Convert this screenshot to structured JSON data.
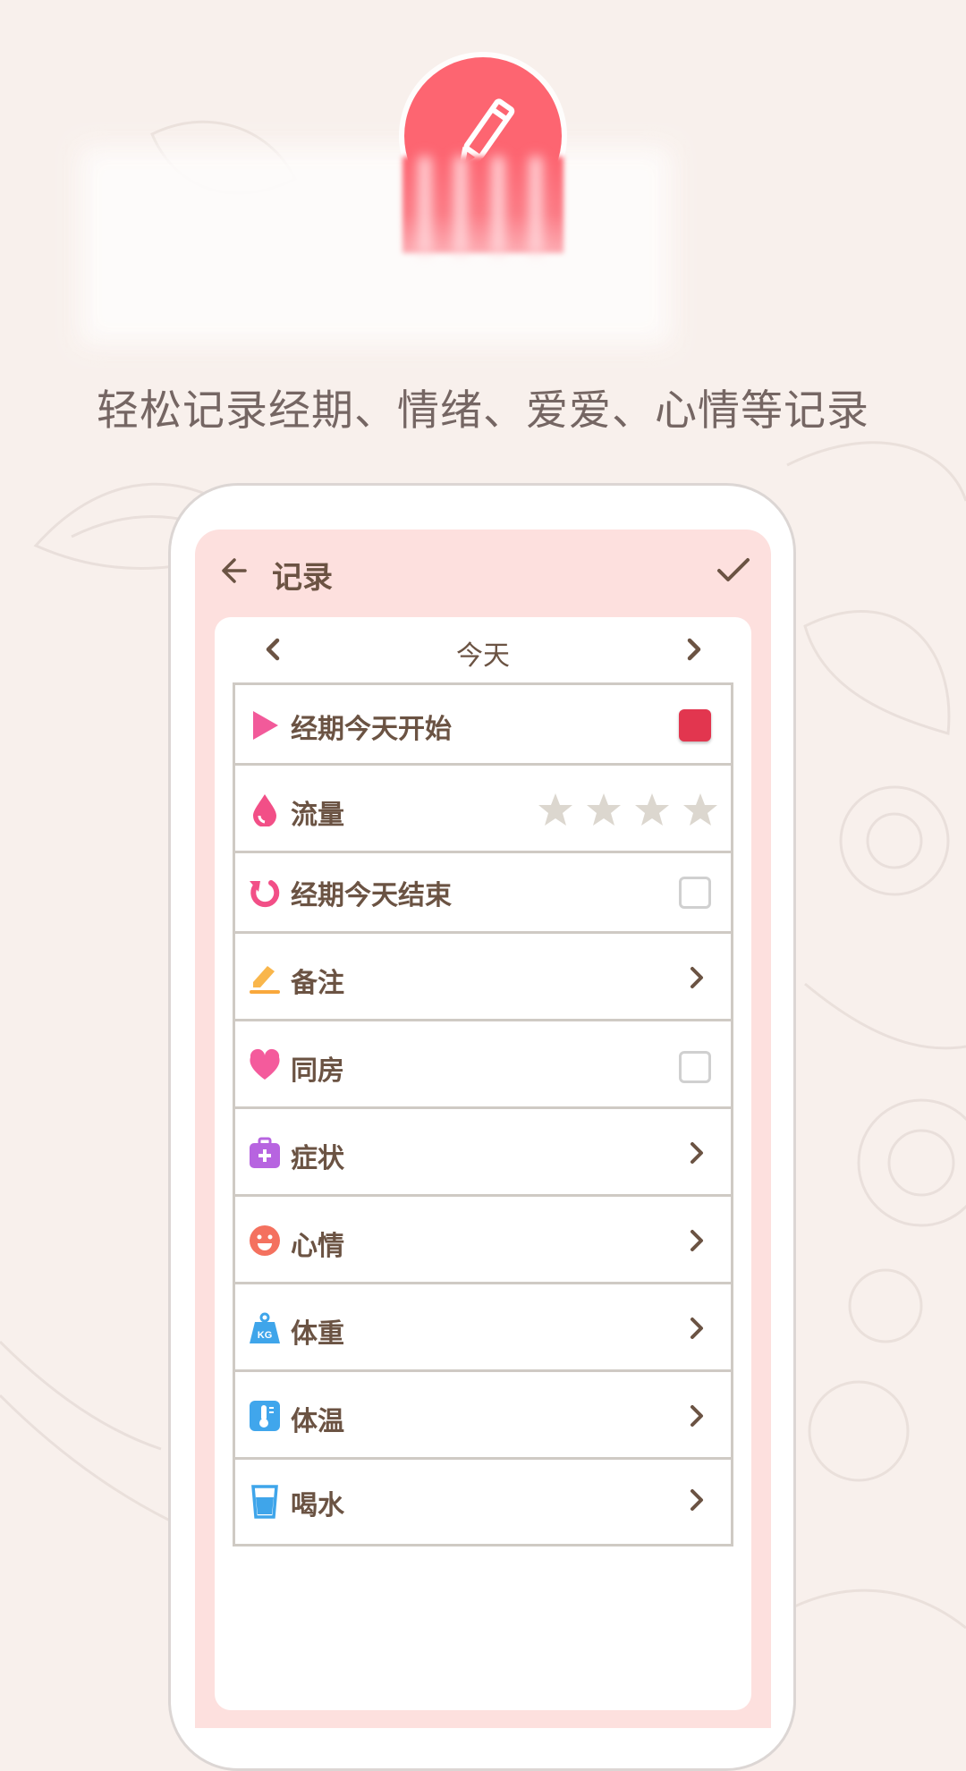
{
  "tagline": "轻松记录经期、情绪、爱爱、心情等记录",
  "header": {
    "title": "记录"
  },
  "date_nav": {
    "label": "今天"
  },
  "rows": [
    {
      "label": "经期今天开始",
      "control": "checkbox",
      "checked": true
    },
    {
      "label": "流量",
      "control": "stars",
      "rating": 0,
      "max": 4
    },
    {
      "label": "经期今天结束",
      "control": "checkbox",
      "checked": false
    },
    {
      "label": "备注",
      "control": "chevron"
    },
    {
      "label": "同房",
      "control": "checkbox",
      "checked": false
    },
    {
      "label": "症状",
      "control": "chevron"
    },
    {
      "label": "心情",
      "control": "chevron"
    },
    {
      "label": "体重",
      "control": "chevron"
    },
    {
      "label": "体温",
      "control": "chevron"
    },
    {
      "label": "喝水",
      "control": "chevron"
    }
  ],
  "icons": [
    "play-icon",
    "drop-icon",
    "restart-icon",
    "note-icon",
    "heart-icon",
    "medkit-icon",
    "smile-icon",
    "weight-icon",
    "thermometer-icon",
    "water-cup-icon"
  ],
  "colors": {
    "accent": "#fd6571",
    "screen_bg": "#fde0de",
    "text": "#6b5343",
    "checked": "#e2364f"
  }
}
